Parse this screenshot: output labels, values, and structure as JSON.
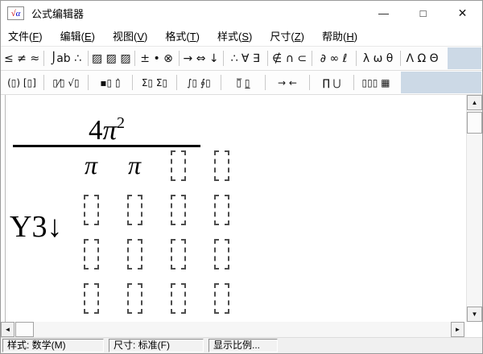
{
  "window": {
    "title": "公式编辑器",
    "icon": {
      "sqrt": "√",
      "alpha": "α"
    },
    "controls": {
      "minimize": "—",
      "maximize": "□",
      "close": "✕"
    }
  },
  "menu": {
    "items": [
      {
        "pre": "文件(",
        "key": "F",
        "post": ")"
      },
      {
        "pre": "编辑(",
        "key": "E",
        "post": ")"
      },
      {
        "pre": "视图(",
        "key": "V",
        "post": ")"
      },
      {
        "pre": "格式(",
        "key": "T",
        "post": ")"
      },
      {
        "pre": "样式(",
        "key": "S",
        "post": ")"
      },
      {
        "pre": "尺寸(",
        "key": "Z",
        "post": ")"
      },
      {
        "pre": "帮助(",
        "key": "H",
        "post": ")"
      }
    ]
  },
  "toolbar_symbols": {
    "buttons": [
      {
        "name": "relational-symbols",
        "glyphs": "≤ ≠ ≈"
      },
      {
        "name": "spaces-ellipses",
        "glyphs": "⌡ab ∴"
      },
      {
        "name": "embellishments",
        "glyphs": "▨ ▨ ▨"
      },
      {
        "name": "operator-symbols",
        "glyphs": "± • ⊗"
      },
      {
        "name": "arrow-symbols",
        "glyphs": "→ ⇔ ↓"
      },
      {
        "name": "logical-symbols",
        "glyphs": "∴ ∀ ∃"
      },
      {
        "name": "set-theory-symbols",
        "glyphs": "∉ ∩ ⊂"
      },
      {
        "name": "misc-symbols",
        "glyphs": "∂ ∞ ℓ"
      },
      {
        "name": "greek-lowercase",
        "glyphs": "λ ω θ"
      },
      {
        "name": "greek-uppercase",
        "glyphs": "Λ Ω Θ"
      }
    ]
  },
  "toolbar_templates": {
    "buttons": [
      {
        "name": "fence-templates",
        "glyphs": "(▯) [▯]"
      },
      {
        "name": "fraction-radical-templates",
        "glyphs": "▯⁄▯ √▯"
      },
      {
        "name": "subscript-superscript-templates",
        "glyphs": "▪▯ ▯̇"
      },
      {
        "name": "summation-templates",
        "glyphs": "Σ▯ Σ▯"
      },
      {
        "name": "integral-templates",
        "glyphs": "∫▯ ∮▯"
      },
      {
        "name": "underbar-overbar-templates",
        "glyphs": "▯̅ ▯̲"
      },
      {
        "name": "labeled-arrow-templates",
        "glyphs": "→ ←"
      },
      {
        "name": "product-set-templates",
        "glyphs": "∏ ⋃"
      },
      {
        "name": "matrix-templates",
        "glyphs": "▯▯▯ ▦"
      }
    ]
  },
  "equation": {
    "numerator": {
      "coefficient": "4",
      "pi": "π",
      "exponent": "2"
    },
    "matrix": {
      "row1": [
        "π",
        "π"
      ],
      "placeholder_rows": 3,
      "placeholder_cols": 4
    },
    "label": {
      "text": "Y3",
      "arrow": "↓"
    }
  },
  "scrollbars": {
    "up_arrow": "▲",
    "down_arrow": "▼",
    "left_arrow": "◄",
    "right_arrow": "►"
  },
  "statusbar": {
    "style": "样式: 数学(M)",
    "size": "尺寸: 标准(F)",
    "zoom": "显示比例..."
  },
  "colors": {
    "toolbar_filler": "#ccd9e6",
    "equation_ink": "#000000"
  }
}
